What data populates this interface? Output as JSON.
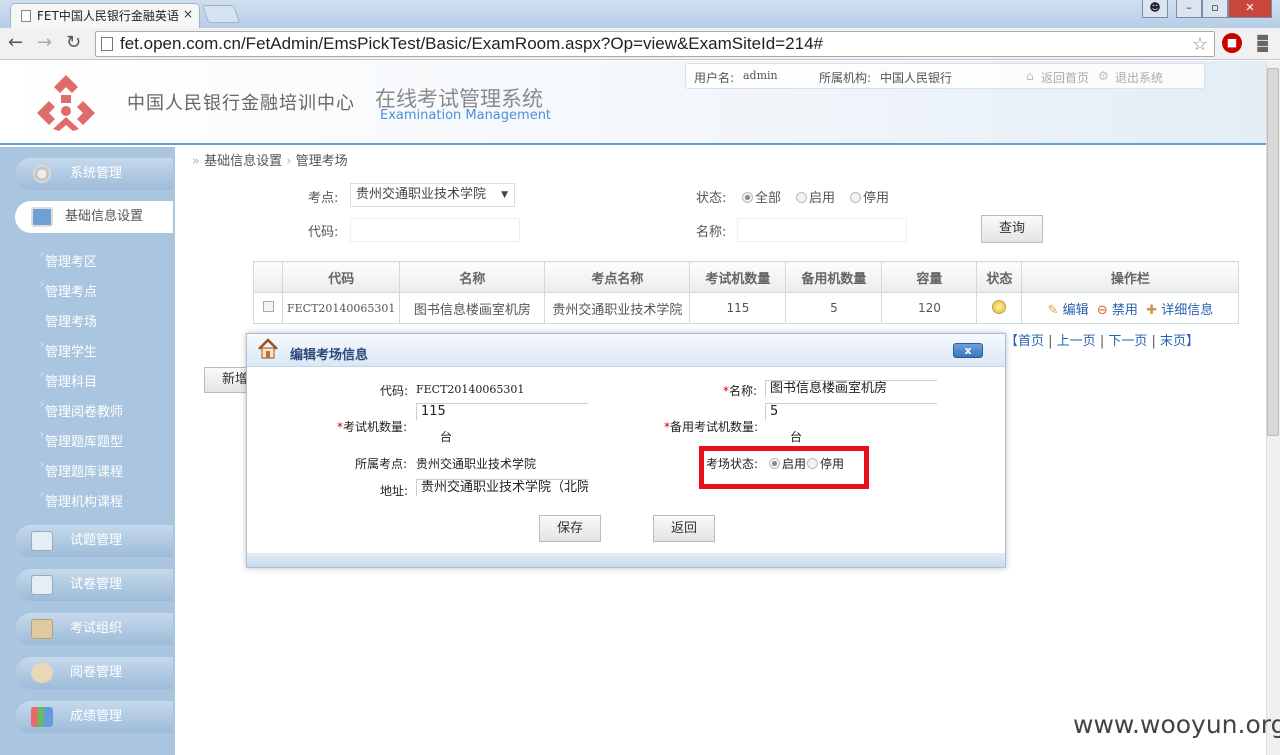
{
  "browser": {
    "tab_title": "FET中国人民银行金融英语",
    "tab_close": "×",
    "url": "fet.open.com.cn/FetAdmin/EmsPickTest/Basic/ExamRoom.aspx?Op=view&ExamSiteId=214#",
    "win_min": "–",
    "win_max": "▫",
    "win_close": "✕"
  },
  "header": {
    "org_name": "中国人民银行金融培训中心",
    "system_title": "在线考试管理系统",
    "system_subtitle": "Examination Management",
    "user_label": "用户名:",
    "user_value": "admin",
    "org_label": "所属机构:",
    "org_value": "中国人民银行",
    "home_link": "返回首页",
    "logout_link": "退出系统"
  },
  "sidebar": {
    "groups": [
      {
        "label": "系统管理"
      },
      {
        "label": "基础信息设置"
      },
      {
        "label": "试题管理"
      },
      {
        "label": "试卷管理"
      },
      {
        "label": "考试组织"
      },
      {
        "label": "阅卷管理"
      },
      {
        "label": "成绩管理"
      }
    ],
    "sub_items": [
      "管理考区",
      "管理考点",
      "管理考场",
      "管理学生",
      "管理科目",
      "管理阅卷教师",
      "管理题库题型",
      "管理题库课程",
      "管理机构课程"
    ]
  },
  "breadcrumb": {
    "root": "基础信息设置",
    "current": "管理考场"
  },
  "filters": {
    "site_label": "考点:",
    "site_value": "贵州交通职业技术学院",
    "status_label": "状态:",
    "status_options": [
      "全部",
      "启用",
      "停用"
    ],
    "code_label": "代码:",
    "name_label": "名称:",
    "query_button": "查询"
  },
  "table": {
    "headers": [
      "代码",
      "名称",
      "考点名称",
      "考试机数量",
      "备用机数量",
      "容量",
      "状态",
      "操作栏"
    ],
    "row": {
      "code": "FECT20140065301",
      "name": "图书信息楼画室机房",
      "site": "贵州交通职业技术学院",
      "exam_count": "115",
      "spare_count": "5",
      "capacity": "120",
      "action_edit": "编辑",
      "action_disable": "禁用",
      "action_detail": "详细信息"
    },
    "pager": [
      "【首页",
      "上一页",
      "下一页",
      "末页】"
    ],
    "add_button_partial": "新增"
  },
  "modal": {
    "title": "编辑考场信息",
    "close": "x",
    "code_label": "代码:",
    "code_value": "FECT20140065301",
    "name_label": "名称:",
    "name_value": "图书信息楼画室机房",
    "exam_count_label": "考试机数量:",
    "exam_count_value": "115",
    "unit": "台",
    "spare_label": "备用考试机数量:",
    "spare_value": "5",
    "site_label": "所属考点:",
    "site_value": "贵州交通职业技术学院",
    "status_label": "考场状态:",
    "status_on": "启用",
    "status_off": "停用",
    "address_label": "地址:",
    "address_value": "贵州交通职业技术学院（北院",
    "save_button": "保存",
    "back_button": "返回",
    "required_mark": "*"
  },
  "watermark": "www.wooyun.org",
  "colors": {
    "accent": "#6c9bd0",
    "sidebar": "#a9c5e0",
    "highlight": "#e8101a",
    "logo": "#e06b6b"
  }
}
